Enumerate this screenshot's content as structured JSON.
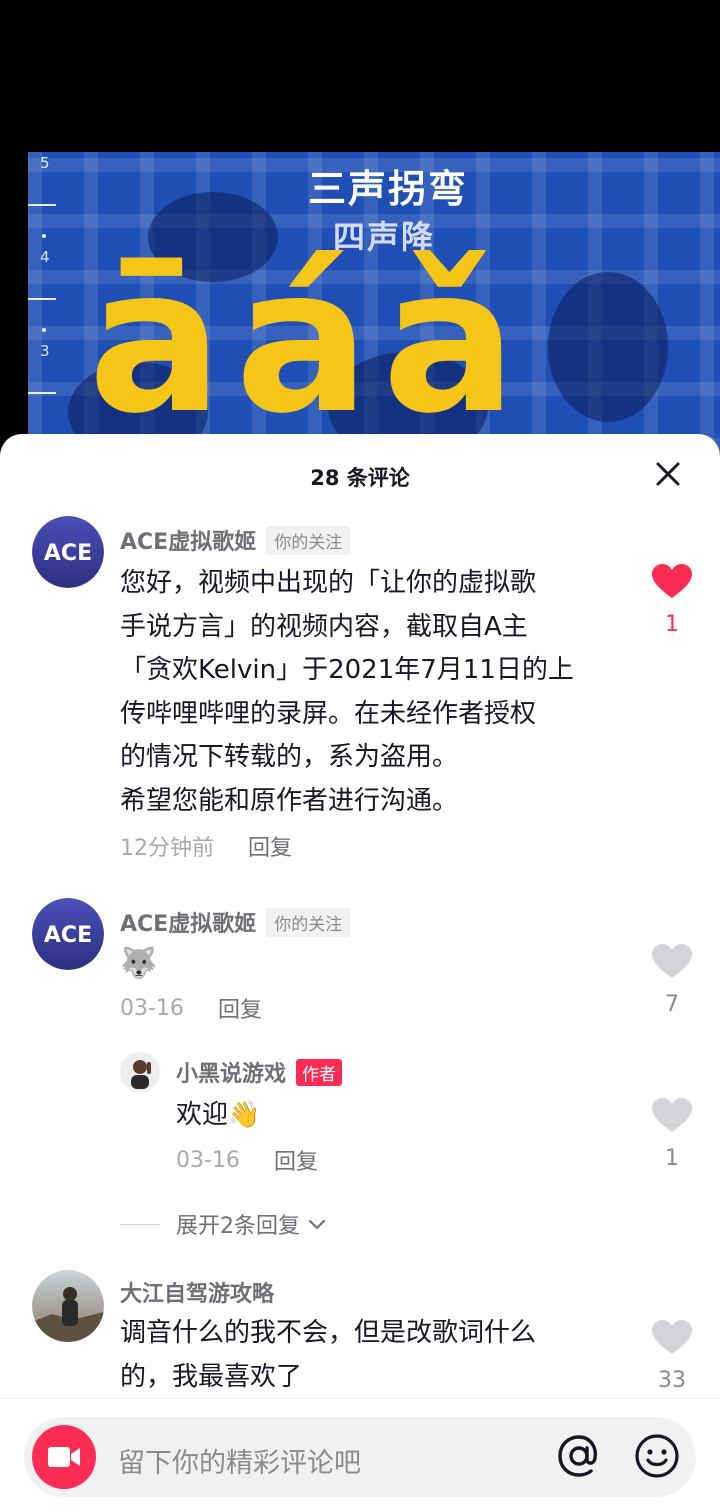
{
  "video": {
    "title": "三声拐弯",
    "subtitle": "四声降",
    "tone_letters": "āáǎ",
    "scale_labels": [
      "5",
      "4",
      "3"
    ]
  },
  "comments_sheet": {
    "title": "28 条评论",
    "close_icon": "close-icon",
    "comments": [
      {
        "username": "ACE虚拟歌姬",
        "follow_tag": "你的关注",
        "text": "您好，视频中出现的「让你的虚拟歌\n手说方言」的视频内容，截取自A主\n「贪欢Kelvin」于2021年7月11日的上\n传哔哩哔哩的录屏。在未经作者授权\n的情况下转载的，系为盗用。\n希望您能和原作者进行沟通。",
        "time": "12分钟前",
        "reply_label": "回复",
        "like_count": "1",
        "liked": true,
        "avatar_text": "ACE"
      },
      {
        "username": "ACE虚拟歌姬",
        "follow_tag": "你的关注",
        "text": "🐺",
        "time": "03-16",
        "reply_label": "回复",
        "like_count": "7",
        "liked": false,
        "avatar_text": "ACE"
      },
      {
        "username": "大江自驾游攻略",
        "text": "调音什么的我不会，但是改歌词什么\n的，我最喜欢了",
        "like_count": "33",
        "liked": false
      }
    ],
    "reply": {
      "username": "小黑说游戏",
      "author_tag": "作者",
      "text": "欢迎👋",
      "time": "03-16",
      "reply_label": "回复",
      "like_count": "1"
    },
    "expand_label": "展开2条回复"
  },
  "input_bar": {
    "placeholder": "留下你的精彩评论吧",
    "icons": [
      "video-camera-icon",
      "at-icon",
      "emoji-icon"
    ]
  },
  "colors": {
    "accent": "#fe2c55",
    "video_bg": "#1f4fb4",
    "tone_yellow": "#f5c518",
    "avatar_ace": "#3b3f9e"
  }
}
